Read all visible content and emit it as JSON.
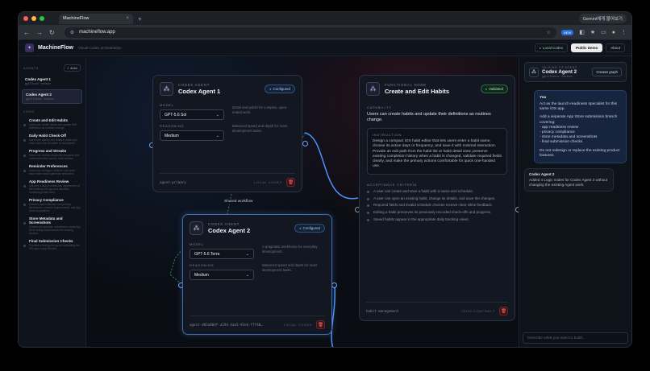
{
  "browser": {
    "tab_title": "MachineFlow",
    "tab_close": "×",
    "new_tab": "+",
    "gemini_label": "Gemini에게 물어보기",
    "url": "machineflow.app",
    "new_badge": "NEW"
  },
  "header": {
    "brand": "MachineFlow",
    "subtitle": "Visual Codex orchestration",
    "local_codex": "Local Codex",
    "public_demo": "Public Demo",
    "about": "About"
  },
  "sidebar": {
    "agents_title": "AGENTS",
    "add_label": "+ Add",
    "agents": [
      {
        "name": "Codex Agent 1",
        "desc": "gpt-5.6-sol · medium"
      },
      {
        "name": "Codex Agent 2",
        "desc": "gpt-5.6-terra · medium"
      }
    ],
    "logic_title": "LOGIC",
    "logic": [
      {
        "name": "Create and Edit Habits",
        "desc": "Users can create habits and update their definitions as routines change."
      },
      {
        "name": "Daily Habit Check-Off",
        "desc": "Users can quickly see today's habits and mark each one complete or incomplete."
      },
      {
        "name": "Progress and Streaks",
        "desc": "Users can review completion progress and understand their current habit streaks."
      },
      {
        "name": "Reminder Preferences",
        "desc": "Users can configure whether and when each habit should generate reminders."
      },
      {
        "name": "App Readiness Review",
        "desc": "Includes a launch readiness assessment of the existing iOS app and identifies remaining polish work."
      },
      {
        "name": "Privacy Compliance",
        "desc": "Ensures data collection and privacy disclosures, consent requirements, and App Store compliance."
      },
      {
        "name": "Store Metadata and Screenshots",
        "desc": "Creates an accurate, submission-ready App Store listing that presents the existing product."
      },
      {
        "name": "Final Submission Checks",
        "desc": "Provides a final go/no-go for submitting the iOS app to App Review."
      }
    ]
  },
  "canvas": {
    "shared_workflow": "Shared workflow",
    "agent1": {
      "kind": "CODEX AGENT",
      "name": "Codex Agent 1",
      "badge": "Configured",
      "model_label": "MODEL",
      "model": "GPT-5.6 Sol",
      "model_help": "Detail and polish for complex, open-ended work.",
      "reasoning_label": "REASONING",
      "reasoning": "Medium",
      "reasoning_help": "Balanced speed and depth for most development tasks.",
      "id": "agent-primary",
      "foot": "LOCAL CODEX"
    },
    "agent2": {
      "kind": "CODEX AGENT",
      "name": "Codex Agent 2",
      "badge": "Configured",
      "model_label": "MODEL",
      "model": "GPT-5.6 Terra",
      "model_help": "A pragmatic workhorse for everyday development.",
      "reasoning_label": "REASONING",
      "reasoning": "Medium",
      "reasoning_help": "Balanced speed and depth for most development tasks.",
      "id": "agent-d03a80df-a194-4ae5-93eb-f7f48…",
      "foot": "LOCAL CODEX"
    },
    "node": {
      "kind": "FUNCTIONAL NODE",
      "name": "Create and Edit Habits",
      "badge": "Validated",
      "capability_label": "CAPABILITY",
      "capability": "Users can create habits and update their definitions as routines change.",
      "instruction_label": "INSTRUCTION",
      "instruction": "Design a compact iOS habit editor that lets users enter a habit name, choose its active days or frequency, and save it with minimal interaction. Provide an edit path from the habit list or habit detail view, preserve existing completion history when a habit is changed, validate required fields clearly, and make the primary actions comfortable for quick one-handed use.",
      "acceptance_label": "ACCEPTANCE CRITERIA",
      "acceptance": [
        "A user can create and save a habit with a name and schedule.",
        "A user can open an existing habit, change its details, and save the changes.",
        "Required fields and invalid schedule choices receive clear inline feedback.",
        "Editing a habit preserves its previously recorded check-offs and progress.",
        "Saved habits appear in the appropriate daily tracking views."
      ],
      "id": "habit-management",
      "foot": "JSON CONTRACT"
    }
  },
  "chat": {
    "talking_label": "TALKING TO AGENT",
    "agent_name": "Codex Agent 2",
    "agent_meta": "gpt-5.6-terra · medium",
    "create_graph": "Creates graph",
    "user_name": "You",
    "user_p1": "Act as the launch-readiness specialist for this same iOS app.",
    "user_p2": "Add a separate App Store submission branch covering:\n- app readiness review\n- privacy compliance\n- store metadata and screenshots\n- final submission checks",
    "user_p3": "Do not redesign or replace the existing product features.",
    "reply_name": "Codex Agent 2",
    "reply_text": "Added 4 Logic nodes for Codex Agent 2 without changing the existing Agent work.",
    "input_placeholder": "Describe what you want to build..."
  },
  "colors": {
    "accent": "#4c95ff",
    "validated": "#33c46b",
    "danger": "#ff6a6a"
  }
}
